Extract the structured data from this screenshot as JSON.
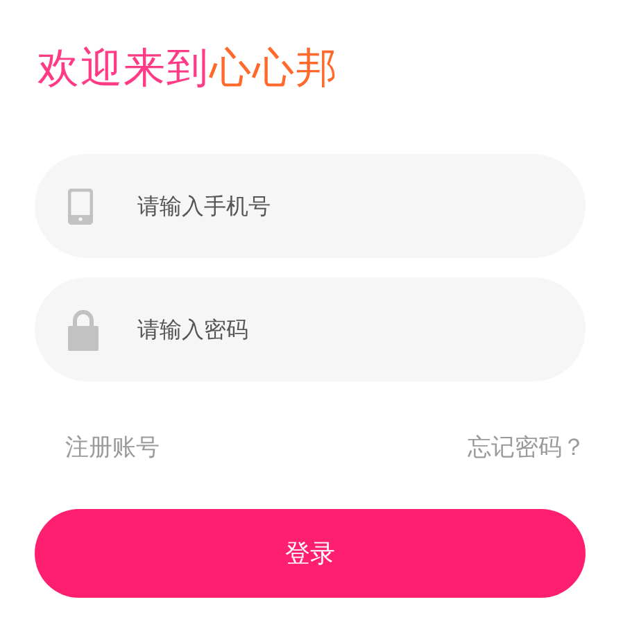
{
  "title": [
    {
      "text": "欢迎来到",
      "color": "#ff3b87"
    },
    {
      "text": "心心邦",
      "color": "#ff6a2c"
    }
  ],
  "fields": [
    {
      "kind": "phone",
      "placeholder": "请输入手机号"
    },
    {
      "kind": "password",
      "placeholder": "请输入密码"
    }
  ],
  "links": {
    "register": "注册账号",
    "forgot": "忘记密码？"
  },
  "login_button": "登录"
}
